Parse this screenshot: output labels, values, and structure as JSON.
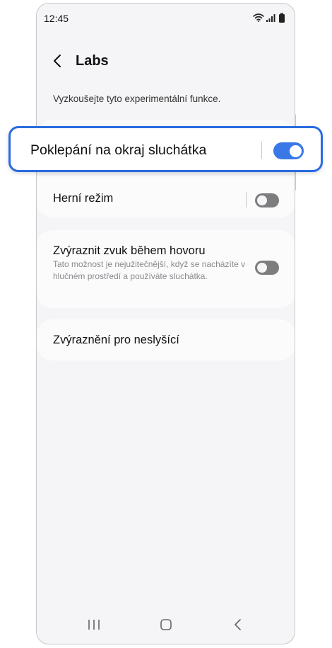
{
  "status_bar": {
    "time": "12:45"
  },
  "header": {
    "title": "Labs"
  },
  "intro_text": "Vyzkoušejte tyto experimentální funkce.",
  "highlighted_setting": {
    "label": "Poklepání na okraj sluchátka",
    "enabled": true
  },
  "settings": [
    {
      "label": "Herní režim",
      "enabled": false
    },
    {
      "label": "Zvýraznit zvuk během hovoru",
      "description": "Tato možnost je nejužitečnější, když se nacházíte v hlučném prostředí a používáte sluchátka.",
      "enabled": false
    },
    {
      "label": "Zvýraznění pro neslyšící"
    }
  ],
  "colors": {
    "accent": "#3a78e8",
    "highlight_border": "#2a6be0",
    "toggle_off": "#7d7d80",
    "background": "#f5f5f7"
  },
  "icons": [
    "wifi-icon",
    "signal-icon",
    "battery-icon",
    "back-arrow-icon",
    "recent-apps-icon",
    "home-icon",
    "back-nav-icon"
  ]
}
